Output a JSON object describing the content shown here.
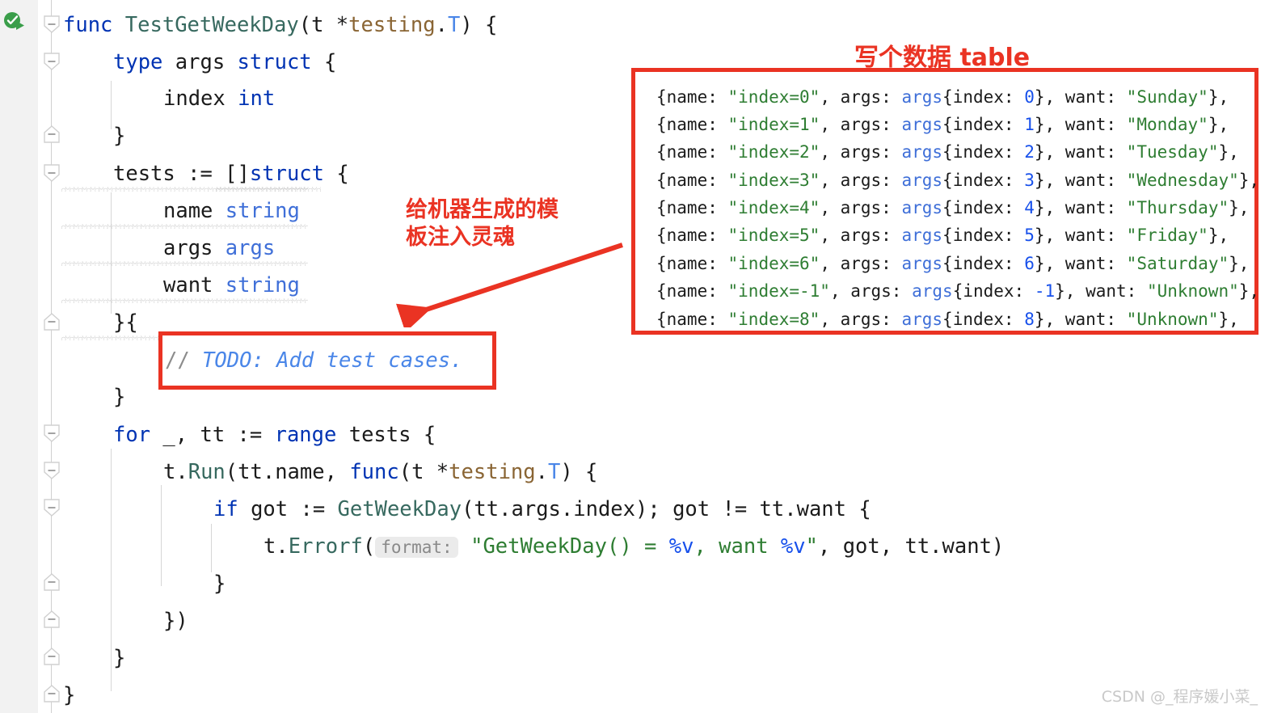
{
  "editor": {
    "language": "go",
    "gutter": {
      "run_test_icon": "run-test-gutter-icon",
      "fold_markers": 11
    },
    "code_lines": [
      {
        "indent": 0,
        "tokens": [
          {
            "t": "func",
            "c": "kw"
          },
          {
            "t": " ",
            "c": "ident"
          },
          {
            "t": "TestGetWeekDay",
            "c": "fn"
          },
          {
            "t": "(t *",
            "c": "ident"
          },
          {
            "t": "testing",
            "c": "pkg"
          },
          {
            "t": ".",
            "c": "ident"
          },
          {
            "t": "T",
            "c": "typ"
          },
          {
            "t": ") {",
            "c": "ident"
          }
        ]
      },
      {
        "indent": 1,
        "tokens": [
          {
            "t": "type",
            "c": "kw"
          },
          {
            "t": " args ",
            "c": "ident"
          },
          {
            "t": "struct",
            "c": "kw"
          },
          {
            "t": " {",
            "c": "ident"
          }
        ]
      },
      {
        "indent": 2,
        "tokens": [
          {
            "t": "index ",
            "c": "ident"
          },
          {
            "t": "int",
            "c": "kw"
          }
        ]
      },
      {
        "indent": 1,
        "tokens": [
          {
            "t": "}",
            "c": "ident"
          }
        ]
      },
      {
        "indent": 1,
        "tokens": [
          {
            "t": "tests := []",
            "c": "ident"
          },
          {
            "t": "struct",
            "c": "kw"
          },
          {
            "t": " {",
            "c": "ident"
          }
        ]
      },
      {
        "indent": 2,
        "tokens": [
          {
            "t": "name ",
            "c": "ident"
          },
          {
            "t": "string",
            "c": "argtype"
          }
        ]
      },
      {
        "indent": 2,
        "tokens": [
          {
            "t": "args ",
            "c": "ident"
          },
          {
            "t": "args",
            "c": "argtype"
          }
        ]
      },
      {
        "indent": 2,
        "tokens": [
          {
            "t": "want ",
            "c": "ident"
          },
          {
            "t": "string",
            "c": "argtype"
          }
        ]
      },
      {
        "indent": 1,
        "tokens": [
          {
            "t": "}{",
            "c": "ident"
          }
        ]
      },
      {
        "indent": 1,
        "tokens": [
          {
            "t": "}",
            "c": "ident"
          }
        ]
      },
      {
        "indent": 1,
        "tokens": [
          {
            "t": "for",
            "c": "kw"
          },
          {
            "t": " _, tt := ",
            "c": "ident"
          },
          {
            "t": "range",
            "c": "kw"
          },
          {
            "t": " tests {",
            "c": "ident"
          }
        ]
      },
      {
        "indent": 2,
        "tokens": [
          {
            "t": "t.",
            "c": "ident"
          },
          {
            "t": "Run",
            "c": "fn"
          },
          {
            "t": "(tt.name, ",
            "c": "ident"
          },
          {
            "t": "func",
            "c": "kw"
          },
          {
            "t": "(t *",
            "c": "ident"
          },
          {
            "t": "testing",
            "c": "pkg"
          },
          {
            "t": ".",
            "c": "ident"
          },
          {
            "t": "T",
            "c": "typ"
          },
          {
            "t": ") {",
            "c": "ident"
          }
        ]
      },
      {
        "indent": 3,
        "tokens": [
          {
            "t": "if",
            "c": "kw"
          },
          {
            "t": " got := ",
            "c": "ident"
          },
          {
            "t": "GetWeekDay",
            "c": "fn"
          },
          {
            "t": "(tt.args.index); got != tt.want {",
            "c": "ident"
          }
        ]
      },
      {
        "indent": 3,
        "tokens": []
      },
      {
        "indent": 3,
        "tokens": [
          {
            "t": "}",
            "c": "ident"
          }
        ]
      },
      {
        "indent": 2,
        "tokens": [
          {
            "t": "})",
            "c": "ident"
          }
        ]
      },
      {
        "indent": 1,
        "tokens": [
          {
            "t": "}",
            "c": "ident"
          }
        ]
      },
      {
        "indent": 0,
        "tokens": [
          {
            "t": "}",
            "c": "ident"
          }
        ]
      }
    ],
    "todo_comment": {
      "slashes": "// ",
      "text": "TODO: Add test cases."
    },
    "errorf_line": {
      "prefix_obj": "t.",
      "call": "Errorf",
      "open_paren": "(",
      "param_hint": "format:",
      "quote_open": "\"",
      "fmt_part1": "GetWeekDay() = ",
      "verb1": "%v",
      "fmt_part2": ", want ",
      "verb2": "%v",
      "quote_close": "\"",
      "suffix": ", got, tt.want)"
    }
  },
  "annotations": {
    "table_label": "写个数据 table",
    "todo_label": "给机器生成的模\n板注入灵魂",
    "arrow": "red-arrow-pointing-to-todo-box",
    "color": "#ea3323"
  },
  "data_table": {
    "rows": [
      {
        "name": "\"index=0\"",
        "index": "0",
        "want": "\"Sunday\""
      },
      {
        "name": "\"index=1\"",
        "index": "1",
        "want": "\"Monday\""
      },
      {
        "name": "\"index=2\"",
        "index": "2",
        "want": "\"Tuesday\""
      },
      {
        "name": "\"index=3\"",
        "index": "3",
        "want": "\"Wednesday\""
      },
      {
        "name": "\"index=4\"",
        "index": "4",
        "want": "\"Thursday\""
      },
      {
        "name": "\"index=5\"",
        "index": "5",
        "want": "\"Friday\""
      },
      {
        "name": "\"index=6\"",
        "index": "6",
        "want": "\"Saturday\""
      },
      {
        "name": "\"index=-1\"",
        "index": "-1",
        "want": "\"Unknown\""
      },
      {
        "name": "\"index=8\"",
        "index": "8",
        "want": "\"Unknown\""
      }
    ],
    "literals": {
      "open": "{name: ",
      "args_key": ", args: ",
      "args_type": "args",
      "index_key": "{index: ",
      "close_brace": "}",
      "want_key": ", want: ",
      "close": "},"
    }
  },
  "watermark": "CSDN @_程序媛小菜_",
  "colors": {
    "keyword": "#0033b3",
    "function": "#37695f",
    "package": "#8a6534",
    "type": "#4a86e8",
    "string": "#2e7d32",
    "number": "#1750eb",
    "comment": "#8c8c8c",
    "annotation_red": "#ea3323",
    "gutter_bg": "#f2f2f2",
    "editor_bg": "#ffffff"
  }
}
